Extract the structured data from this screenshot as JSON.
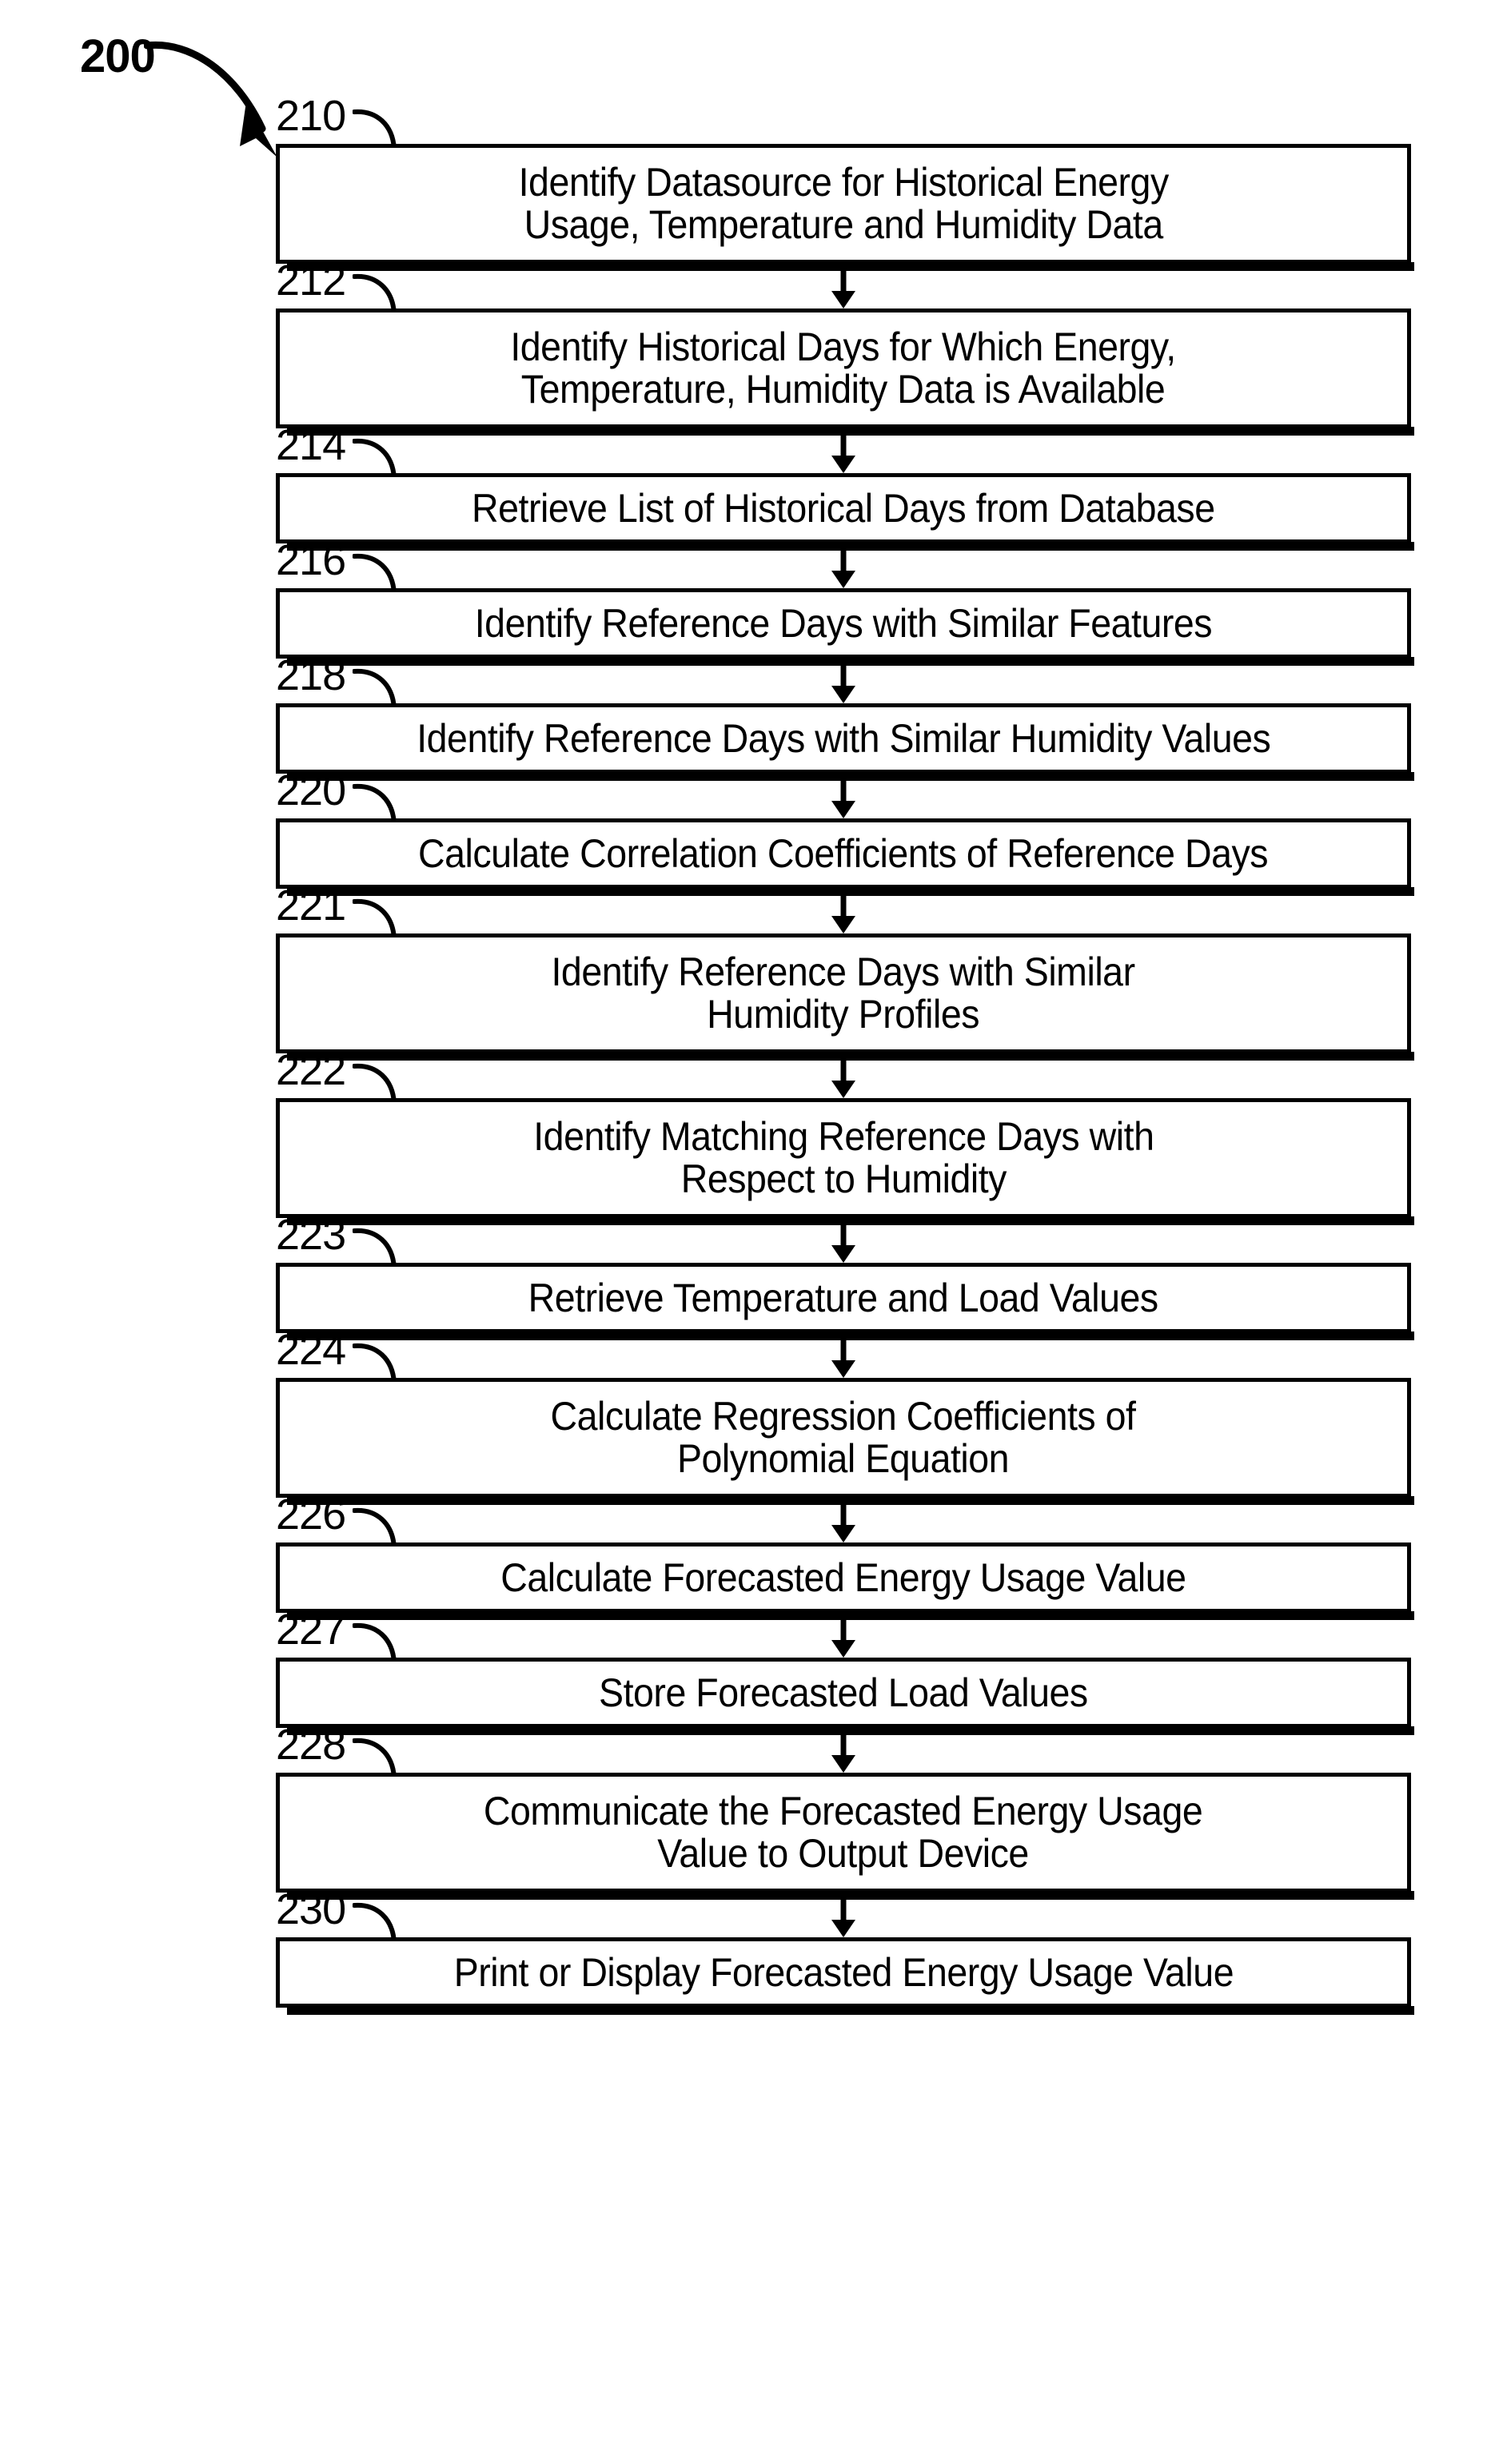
{
  "figure": {
    "number": "200",
    "arrow_icon": "curved-arrow-icon"
  },
  "flowchart": {
    "orientation": "vertical",
    "connector_icon": "down-arrow-icon",
    "steps": [
      {
        "ref": "210",
        "label": "Identify Datasource for Historical Energy\nUsage, Temperature and Humidity Data",
        "lines": 2
      },
      {
        "ref": "212",
        "label": "Identify Historical Days for Which Energy,\nTemperature, Humidity Data is Available",
        "lines": 2
      },
      {
        "ref": "214",
        "label": "Retrieve List of Historical Days from Database",
        "lines": 1
      },
      {
        "ref": "216",
        "label": "Identify Reference Days with Similar Features",
        "lines": 1
      },
      {
        "ref": "218",
        "label": "Identify Reference Days with Similar Humidity Values",
        "lines": 1
      },
      {
        "ref": "220",
        "label": "Calculate Correlation Coefficients of Reference Days",
        "lines": 1
      },
      {
        "ref": "221",
        "label": "Identify Reference Days with Similar\nHumidity Profiles",
        "lines": 2
      },
      {
        "ref": "222",
        "label": "Identify Matching Reference Days with\nRespect to Humidity",
        "lines": 2
      },
      {
        "ref": "223",
        "label": "Retrieve Temperature and Load Values",
        "lines": 1
      },
      {
        "ref": "224",
        "label": "Calculate Regression Coefficients of\nPolynomial Equation",
        "lines": 2
      },
      {
        "ref": "226",
        "label": "Calculate Forecasted Energy Usage Value",
        "lines": 1
      },
      {
        "ref": "227",
        "label": "Store Forecasted Load Values",
        "lines": 1
      },
      {
        "ref": "228",
        "label": "Communicate the Forecasted Energy Usage\nValue to Output Device",
        "lines": 2
      },
      {
        "ref": "230",
        "label": "Print or Display Forecasted Energy Usage Value",
        "lines": 1
      }
    ]
  },
  "colors": {
    "ink": "#000000",
    "paper": "#ffffff"
  }
}
